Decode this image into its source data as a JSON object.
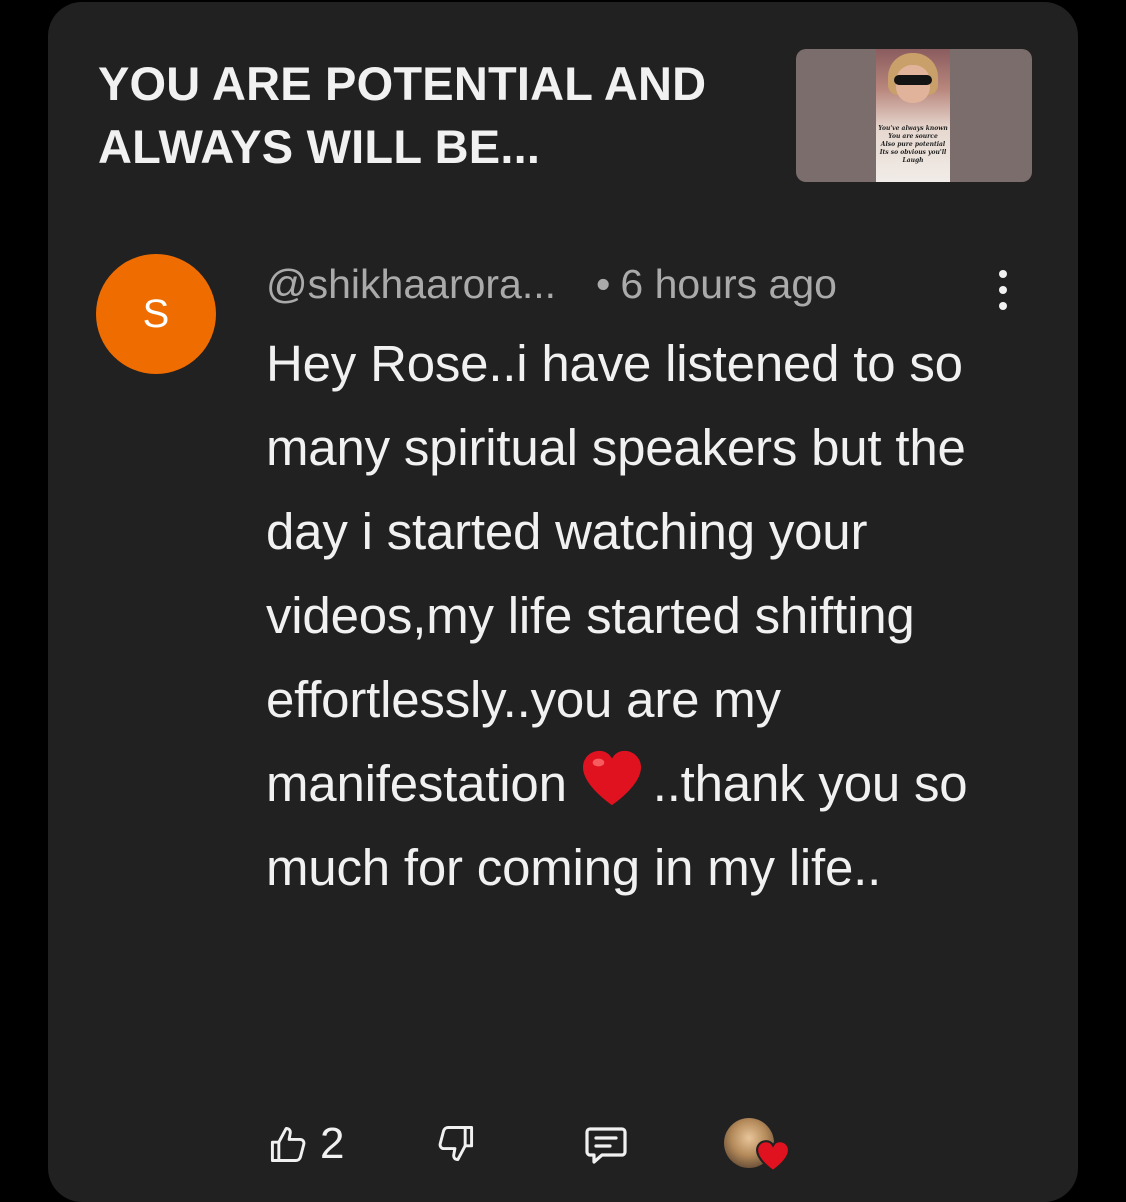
{
  "video": {
    "title": "YOU ARE POTENTIAL AND ALWAYS WILL BE...",
    "thumbnail_caption": [
      "You've always known",
      "You are source",
      "Also pure potential",
      "Its so obvious you'll",
      "Laugh"
    ]
  },
  "comment": {
    "avatar_letter": "S",
    "avatar_color": "#ef6c00",
    "author": "@shikhaarora...",
    "time": "6 hours ago",
    "text_before_emoji": "Hey Rose..i have listened to so many spiritual speakers but the day i started watching your videos,my life started shifting effortlessly..you are my manifestation",
    "emoji": "red-heart",
    "text_after_emoji": "..thank you so much for coming in my life..",
    "likes": "2"
  },
  "icons": {
    "menu": "vertical-ellipsis-icon",
    "like": "thumbs-up-icon",
    "dislike": "thumbs-down-icon",
    "reply": "reply-comment-icon",
    "creator_heart": "creator-heart-icon"
  }
}
